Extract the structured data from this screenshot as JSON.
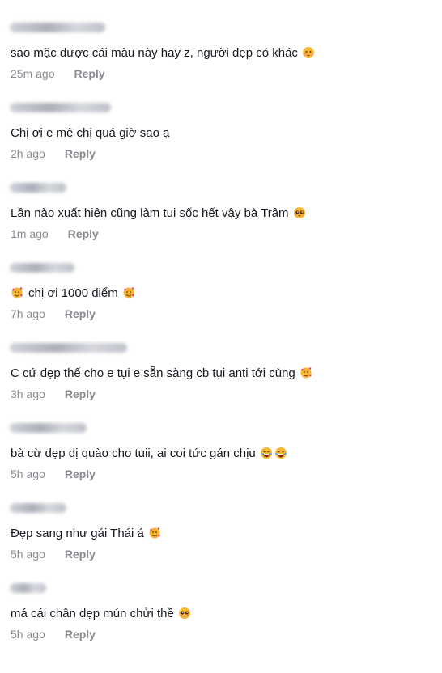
{
  "comments": [
    {
      "text": "sao mặc dược cái màu này hay z, người dẹp có khác",
      "emoji_after": [
        "shy-face"
      ],
      "time": "25m ago",
      "reply": "Reply"
    },
    {
      "text": "Chị ơi e mê chị quá giờ sao ạ",
      "emoji_after": [],
      "time": "2h ago",
      "reply": "Reply"
    },
    {
      "text": "Lần nào xuất hiện cũng làm tui sốc hết vậy bà Trâm",
      "emoji_after": [
        "pleading-face"
      ],
      "time": "1m ago",
      "reply": "Reply"
    },
    {
      "text": "chị ơi 1000 diểm",
      "emoji_before": [
        "smiling-face-with-hearts"
      ],
      "emoji_after": [
        "smiling-face-with-hearts"
      ],
      "time": "7h ago",
      "reply": "Reply"
    },
    {
      "text": "C cứ dẹp thế cho e tụi e sẵn sàng cb tụi anti tới cùng",
      "emoji_after": [
        "smiling-face-with-hearts"
      ],
      "time": "3h ago",
      "reply": "Reply"
    },
    {
      "text": "bà cừ dẹp dị quào cho tuii, ai coi tức gán chịu",
      "emoji_after": [
        "laughing-face",
        "laughing-face"
      ],
      "time": "5h ago",
      "reply": "Reply"
    },
    {
      "text": "Đẹp sang như gái Thái á",
      "emoji_after": [
        "smiling-face-with-hearts"
      ],
      "time": "5h ago",
      "reply": "Reply"
    },
    {
      "text": "má cái chân dẹp mún chửi thề",
      "emoji_after": [
        "pleading-face"
      ],
      "time": "5h ago",
      "reply": "Reply"
    }
  ],
  "colors": {
    "text": "#161823",
    "meta": "#8a8b91",
    "emoji_face": "#f7b733",
    "emoji_heart": "#ee3b6b"
  }
}
